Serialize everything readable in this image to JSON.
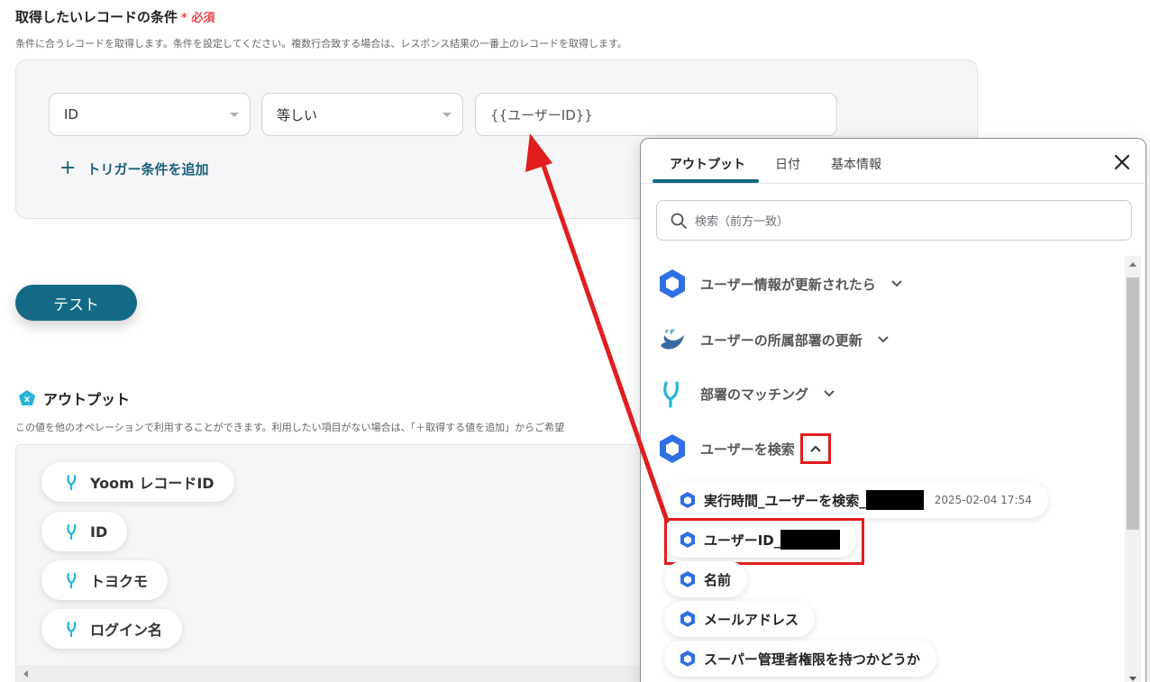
{
  "conditions": {
    "title": "取得したいレコードの条件",
    "required": "必須",
    "description": "条件に合うレコードを取得します。条件を設定してください。複数行合致する場合は、レスポンス結果の一番上のレコードを取得します。",
    "field": "ID",
    "operator": "等しい",
    "value": "{{ユーザーID}}",
    "add_label": "トリガー条件を追加"
  },
  "test_label": "テスト",
  "output": {
    "title": "アウトプット",
    "description": "この値を他のオペレーションで利用することができます。利用したい項目がない場合は、「＋取得する値を追加」からご希望",
    "items": [
      "Yoom レコードID",
      "ID",
      "トヨクモ",
      "ログイン名"
    ]
  },
  "panel": {
    "tabs": [
      "アウトプット",
      "日付",
      "基本情報"
    ],
    "search_placeholder": "検索（前方一致）",
    "groups": [
      {
        "label": "ユーザー情報が更新されたら",
        "icon": "google-workspace-icon"
      },
      {
        "label": "ユーザーの所属部署の更新",
        "icon": "bird-logo-icon"
      },
      {
        "label": "部署のマッチング",
        "icon": "yoom-logo-icon"
      },
      {
        "label": "ユーザーを検索",
        "icon": "google-workspace-icon"
      }
    ],
    "items": [
      {
        "label": "実行時間_ユーザーを検索_",
        "value": "2025-02-04 17:54"
      },
      {
        "label": "ユーザーID_"
      },
      {
        "label": "名前"
      },
      {
        "label": "メールアドレス"
      },
      {
        "label": "スーパー管理者権限を持つかどうか"
      }
    ]
  },
  "colors": {
    "accent": "#146a85",
    "highlight": "#e11d1d",
    "required": "#e5484d",
    "hex_blue": "#2f6fe4"
  }
}
